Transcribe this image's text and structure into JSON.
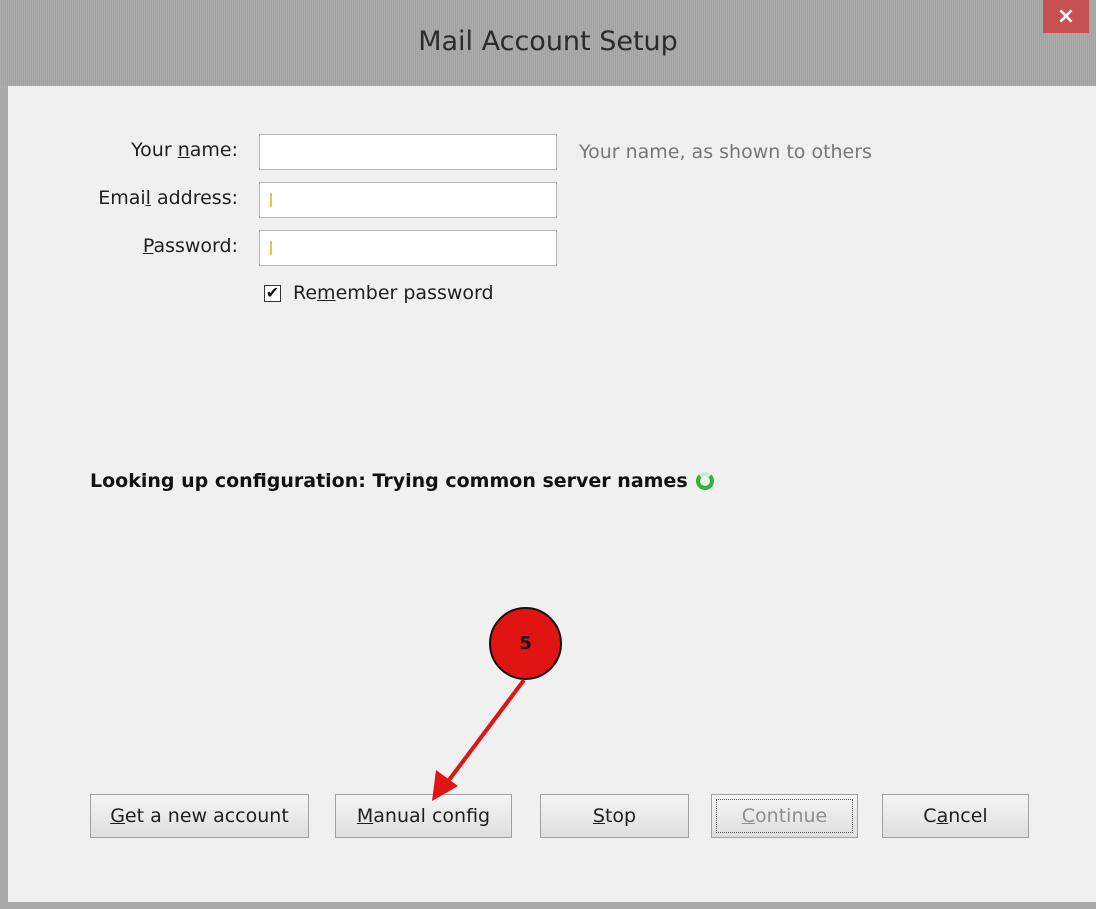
{
  "window": {
    "title": "Mail Account Setup",
    "close_glyph": "×"
  },
  "form": {
    "name_label_pre": "Your ",
    "name_label_key": "n",
    "name_label_post": "ame:",
    "email_label_pre": "Emai",
    "email_label_key": "l",
    "email_label_post": " address:",
    "password_label_pre": "",
    "password_label_key": "P",
    "password_label_post": "assword:",
    "name_value": "",
    "email_value": "",
    "password_value": "",
    "name_hint": "Your name, as shown to others",
    "remember_pre": "Re",
    "remember_key": "m",
    "remember_post": "ember password",
    "remember_checked": true,
    "check_glyph": "✔"
  },
  "status": {
    "text": "Looking up configuration: Trying common server names"
  },
  "buttons": {
    "get_new_pre": "",
    "get_new_key": "G",
    "get_new_post": "et a new account",
    "manual_pre": "",
    "manual_key": "M",
    "manual_post": "anual config",
    "stop_pre": "",
    "stop_key": "S",
    "stop_post": "top",
    "continue_pre": "",
    "continue_key": "C",
    "continue_post": "ontinue",
    "cancel_pre": "C",
    "cancel_key": "a",
    "cancel_post": "ncel"
  },
  "annotation": {
    "step_number": "5",
    "color": "#e11414"
  },
  "colors": {
    "titlebar": "#a8a8a8",
    "close": "#c75050",
    "background": "#f0f0f0",
    "spinner": "#2fb52f"
  },
  "icons": {
    "close": "close-icon",
    "spinner": "loading-spinner-icon",
    "checkbox": "checkmark-icon"
  }
}
